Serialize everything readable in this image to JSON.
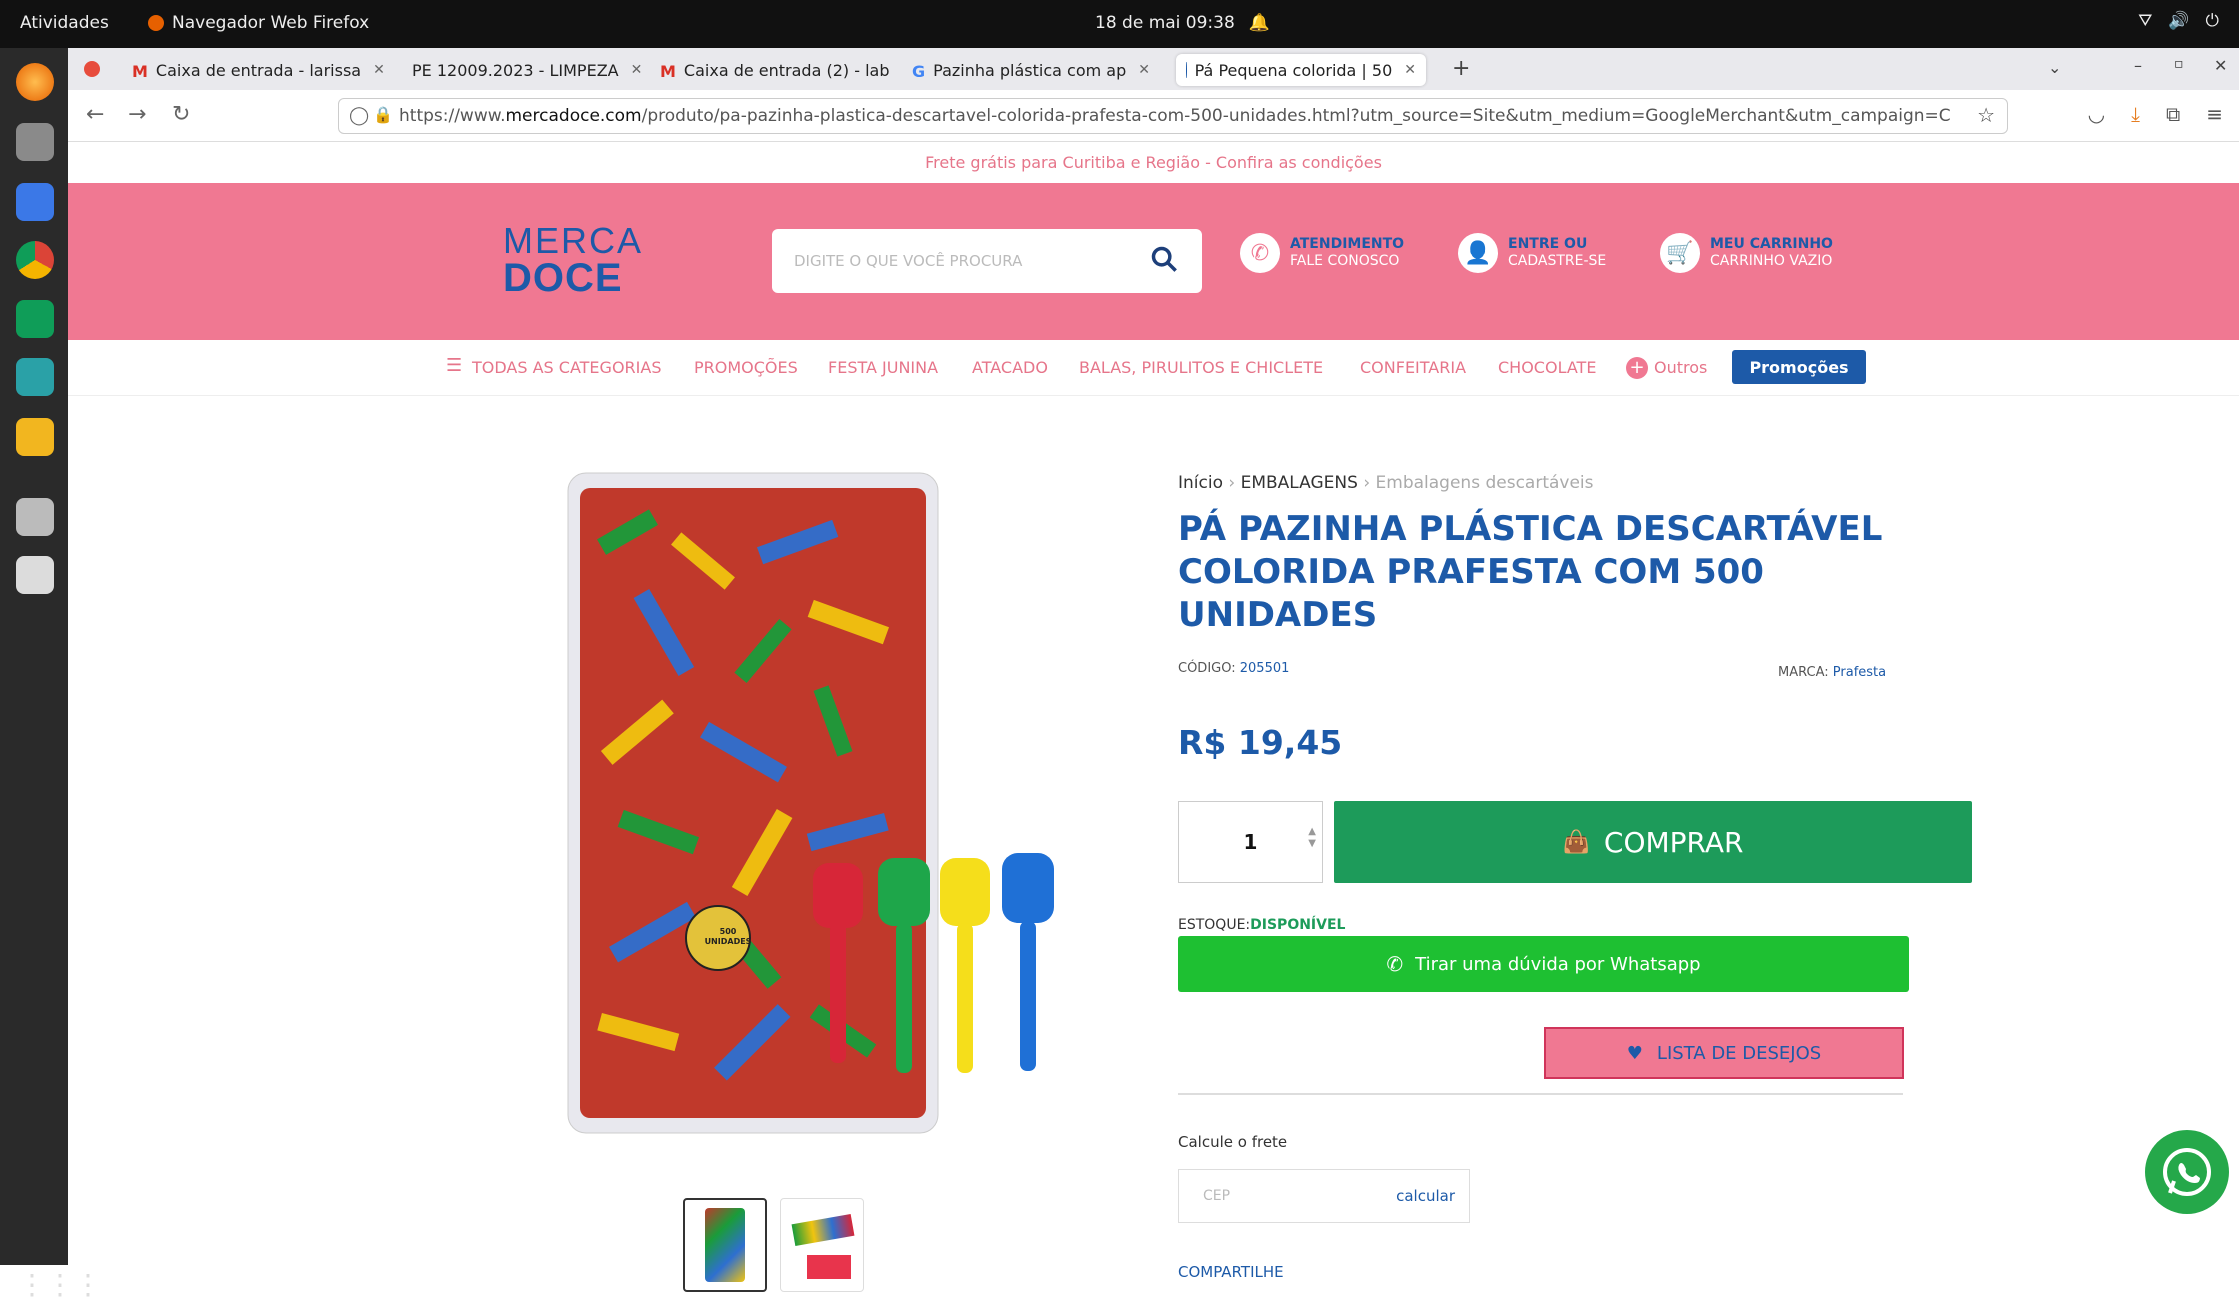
{
  "os": {
    "activities": "Atividades",
    "app_name": "Navegador Web Firefox",
    "clock": "18 de mai  09:38"
  },
  "tabs": [
    {
      "label": "Caixa de entrada - larissa",
      "icon": "gmail-icon"
    },
    {
      "label": "PE 12009.2023 - LIMPEZA",
      "icon": "sheets-icon"
    },
    {
      "label": "Caixa de entrada (2) - lab",
      "icon": "gmail-icon"
    },
    {
      "label": "Pazinha plástica com ap",
      "icon": "google-icon"
    },
    {
      "label": "Pá Pequena colorida | 50",
      "icon": "site-icon"
    }
  ],
  "url": {
    "prefix": "https://www.",
    "domain": "mercadoce.com",
    "path": "/produto/pa-pazinha-plastica-descartavel-colorida-prafesta-com-500-unidades.html?utm_source=Site&utm_medium=GoogleMerchant&utm_campaign=C"
  },
  "site": {
    "promo_strip": "Frete grátis para Curitiba e Região - Confira as condições",
    "logo_line1": "MERCA",
    "logo_line2": "DOCE",
    "search_placeholder": "DIGITE O QUE VOCÊ PROCURA",
    "header_items": [
      {
        "title": "ATENDIMENTO",
        "sub": "FALE CONOSCO"
      },
      {
        "title": "ENTRE OU",
        "sub": "CADASTRE-SE"
      },
      {
        "title": "MEU CARRINHO",
        "sub": "CARRINHO VAZIO"
      }
    ],
    "categories": [
      "TODAS AS CATEGORIAS",
      "PROMOÇÕES",
      "FESTA JUNINA",
      "ATACADO",
      "BALAS, PIRULITOS E CHICLETE",
      "CONFEITARIA",
      "CHOCOLATE",
      "Outros"
    ],
    "promo_button": "Promoções"
  },
  "product": {
    "breadcrumb_home": "Início",
    "breadcrumb_sep": " › ",
    "breadcrumb_cat": "EMBALAGENS",
    "breadcrumb_sub": "Embalagens descartáveis",
    "title": "PÁ PAZINHA PLÁSTICA DESCARTÁVEL COLORIDA PRAFESTA COM 500 UNIDADES",
    "code_label": "CÓDIGO:",
    "code": "205501",
    "brand_label": "MARCA:",
    "brand": "Prafesta",
    "price": "R$ 19,45",
    "quantity": "1",
    "buy_label": "COMPRAR",
    "stock_label": "ESTOQUE:",
    "stock_value": "DISPONÍVEL",
    "whatsapp_label": "Tirar uma dúvida por Whatsapp",
    "wishlist_label": "LISTA DE DESEJOS",
    "frete_label": "Calcule o frete",
    "cep_placeholder": "CEP",
    "calc_label": "calcular",
    "share_label": "COMPARTILHE",
    "bag_text": "500 UNIDADES"
  },
  "colors": {
    "pink": "#f07892",
    "blue": "#1d5aa8",
    "green": "#1d9b5a",
    "whatsapp": "#1ec032"
  }
}
